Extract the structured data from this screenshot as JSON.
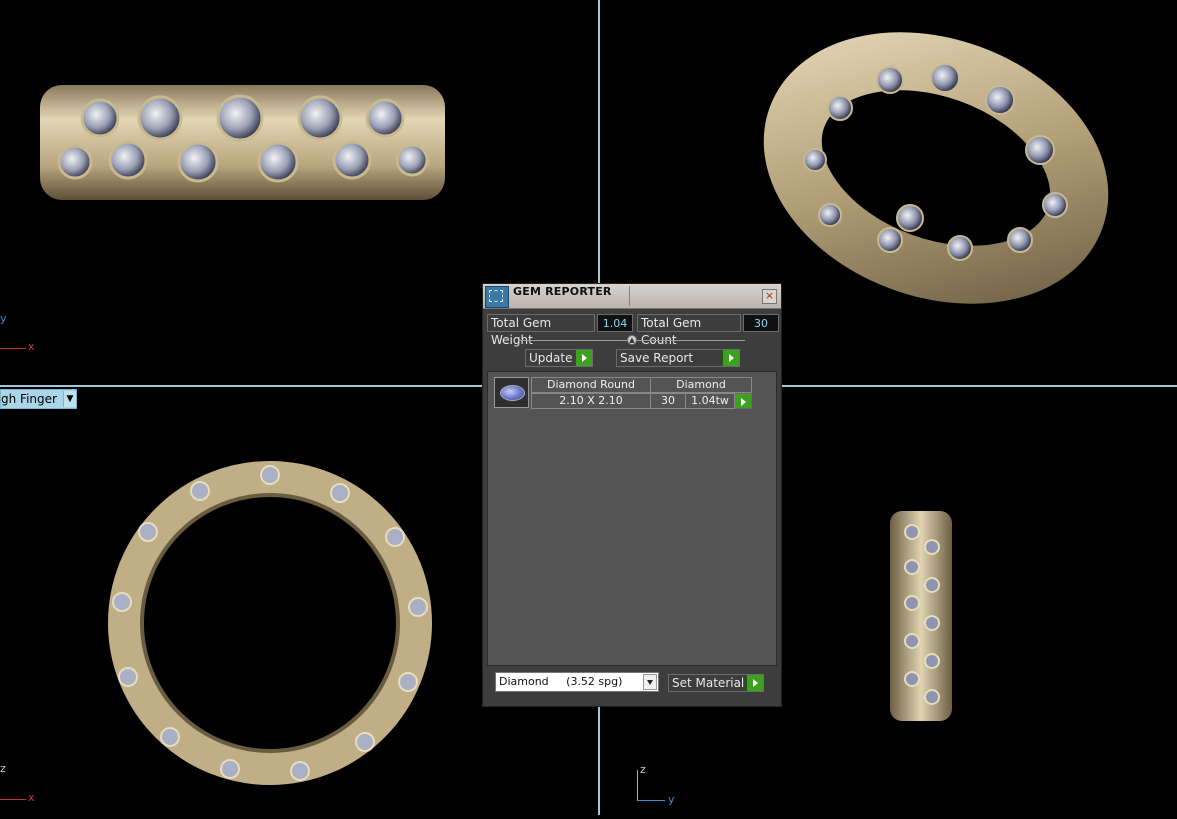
{
  "viewports": {
    "top_left_axes": {
      "y": "y",
      "x": "x"
    },
    "bottom_left_axes": {
      "z": "z",
      "x": "x"
    },
    "bottom_right_axes": {
      "z": "z",
      "y": "y"
    },
    "view_dropdown_label": "gh Finger"
  },
  "colors": {
    "accent_green": "#3ea021",
    "value_cyan": "#8fd6ee",
    "panel_bg": "#3d3d3d",
    "divider": "#9fc7d9"
  },
  "panel": {
    "title": "GEM REPORTER",
    "title_icon": "gem-reporter-icon",
    "total_weight_label": "Total Gem Weight",
    "total_weight_value": "1.04",
    "total_count_label": "Total Gem Count",
    "total_count_value": "30",
    "update_label": "Update",
    "save_report_label": "Save Report",
    "gem_rows": [
      {
        "shape": "Diamond Round",
        "material": "Diamond",
        "size": "2.10 X 2.10",
        "count": "30",
        "weight": "1.04tw"
      }
    ],
    "material_select": "Diamond     (3.52 spg)",
    "set_material_label": "Set Material"
  }
}
